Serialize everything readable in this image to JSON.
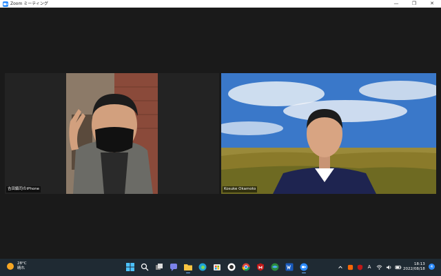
{
  "window": {
    "title": "Zoom ミーティング",
    "controls": {
      "minimize": "—",
      "restore": "❐",
      "close": "✕"
    }
  },
  "participants": [
    {
      "name": "吉田鎮司のiPhone"
    },
    {
      "name": "Kosuke Okamoto"
    }
  ],
  "taskbar": {
    "weather": {
      "temp": "28°C",
      "condition": "晴れ"
    },
    "apps": [
      "start",
      "search",
      "task-view",
      "teams",
      "file-explorer",
      "edge",
      "store",
      "app",
      "chrome",
      "mcafee",
      "maps",
      "word",
      "zoom"
    ],
    "tray": {
      "ime": "A"
    },
    "clock": {
      "time": "18:13",
      "date": "2022/08/18"
    },
    "notification_count": "4"
  },
  "colors": {
    "taskbar": "#1f2a33",
    "zoom_blue": "#2d8cff",
    "meeting_bg": "#1a1a1a"
  }
}
